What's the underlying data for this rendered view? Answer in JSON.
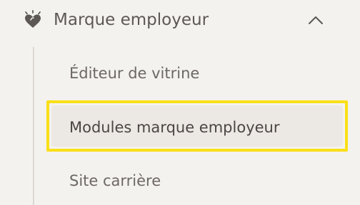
{
  "nav_section": {
    "title": "Marque employeur",
    "icon": "heart-sparkle-icon",
    "expanded": true,
    "toggle_icon": "chevron-up-icon",
    "items": [
      {
        "label": "Éditeur de vitrine",
        "active": false
      },
      {
        "label": "Modules marque employeur",
        "active": true
      },
      {
        "label": "Site carrière",
        "active": false
      }
    ]
  },
  "colors": {
    "background": "#f4f2ee",
    "text": "#5d5856",
    "active_background": "#ece8e3",
    "focus_outline": "#fadf17"
  }
}
